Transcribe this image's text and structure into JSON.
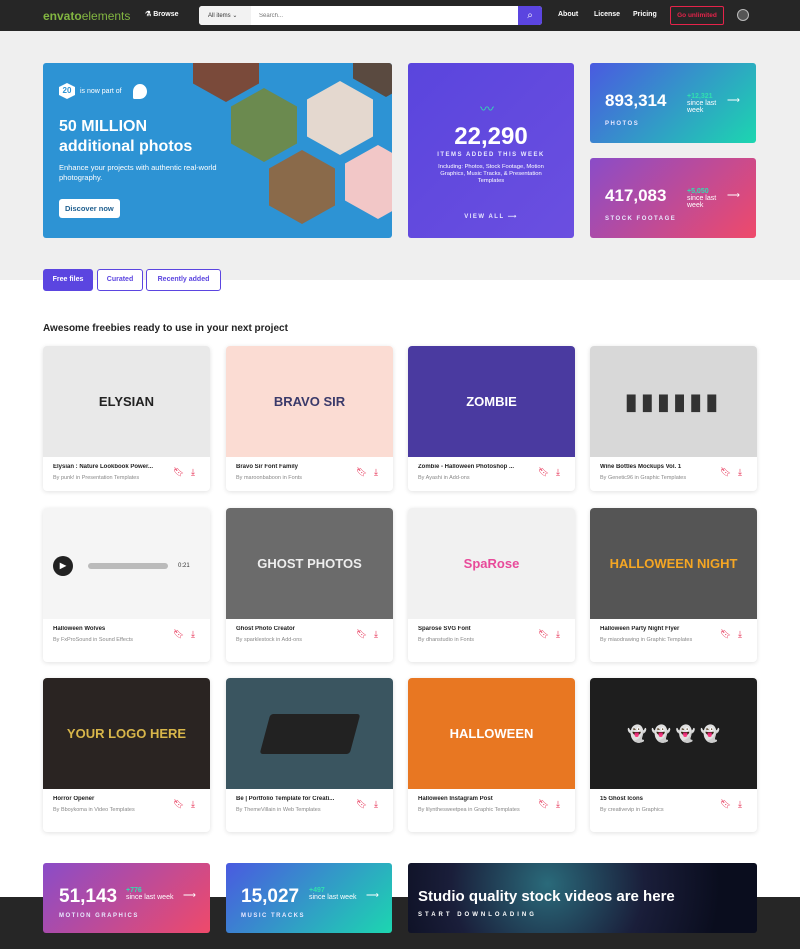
{
  "header": {
    "logo_a": "envato",
    "logo_b": "elements",
    "browse": "Browse",
    "search_category": "All items ⌄",
    "search_placeholder": "Search...",
    "nav": [
      "About",
      "License",
      "Pricing"
    ],
    "cta": "Go unlimited"
  },
  "hero": {
    "badge": "20",
    "part_of": "is now part of",
    "title_1": "50 MILLION",
    "title_2": "additional photos",
    "subtitle": "Enhance your projects with authentic real-world photography.",
    "button": "Discover now",
    "weekly": {
      "count": "22,290",
      "label": "ITEMS ADDED THIS WEEK",
      "desc": "Including: Photos, Stock Footage, Motion Graphics, Music Tracks, & Presentation Templates",
      "link": "VIEW ALL ⟶"
    },
    "photos": {
      "count": "893,314",
      "delta": "+12,321",
      "since": "since last week",
      "label": "PHOTOS"
    },
    "footage": {
      "count": "417,083",
      "delta": "+5,050",
      "since": "since last week",
      "label": "STOCK FOOTAGE"
    }
  },
  "tabs": [
    "Free files",
    "Curated",
    "Recently added"
  ],
  "section_title": "Awesome freebies ready to use in your next project",
  "items": [
    {
      "title": "Elysian : Nature Lookbook Power...",
      "by": "By punk! in Presentation Templates",
      "thumb": "ELYSIAN",
      "bg": "#e9e9e9",
      "fg": "#222"
    },
    {
      "title": "Bravo Sir Font Family",
      "by": "By maroonbaboon in Fonts",
      "thumb": "BRAVO SIR",
      "bg": "#fbdcd3",
      "fg": "#3a3a6a"
    },
    {
      "title": "Zombie - Halloween Photoshop ...",
      "by": "By Ayashi in Add-ons",
      "thumb": "ZOMBIE",
      "bg": "#4a3aa0",
      "fg": "#fff"
    },
    {
      "title": "Wine Bottles Mockups Vol. 1",
      "by": "By Genetic96 in Graphic Templates",
      "thumb": "",
      "bg": "#d8d8d8",
      "fg": "#333"
    },
    {
      "title": "Halloween Wolves",
      "by": "By FxProSound in Sound Effects",
      "thumb": "",
      "duration": "0:21",
      "bg": "#f5f5f5",
      "fg": "#333"
    },
    {
      "title": "Ghost Photo Creator",
      "by": "By sparklestock in Add-ons",
      "thumb": "GHOST PHOTOS",
      "bg": "#6b6b6b",
      "fg": "#eee"
    },
    {
      "title": "Sparose SVG Font",
      "by": "By dhanstudio in Fonts",
      "thumb": "SpaRose",
      "bg": "#f1f1f1",
      "fg": "#e84a9a"
    },
    {
      "title": "Halloween Party Night Flyer",
      "by": "By miaodrawing in Graphic Templates",
      "thumb": "HALLOWEEN NIGHT",
      "bg": "#555",
      "fg": "#f5a623"
    },
    {
      "title": "Horror Opener",
      "by": "By Bboykoma in Video Templates",
      "thumb": "YOUR LOGO HERE",
      "bg": "#2a2422",
      "fg": "#d8b64a"
    },
    {
      "title": "Be | Portfolio Template for Creati...",
      "by": "By ThemeVillain in Web Templates",
      "thumb": "",
      "bg": "#3a5560",
      "fg": "#fff"
    },
    {
      "title": "Halloween Instagram Post",
      "by": "By lilynthesweetpea in Graphic Templates",
      "thumb": "HALLOWEEN",
      "bg": "#e87722",
      "fg": "#fff"
    },
    {
      "title": "15 Ghost Icons",
      "by": "By creativevip in Graphics",
      "thumb": "👻 👻 👻 👻",
      "bg": "#1e1e1e",
      "fg": "#fff"
    }
  ],
  "bottom": {
    "motion": {
      "count": "51,143",
      "delta": "+776",
      "since": "since last week",
      "label": "MOTION GRAPHICS"
    },
    "music": {
      "count": "15,027",
      "delta": "+497",
      "since": "since last week",
      "label": "MUSIC TRACKS"
    },
    "promo": {
      "title": "Studio quality stock videos are here",
      "cta": "START DOWNLOADING"
    }
  },
  "colors": {
    "accent": "#5b45e0",
    "brand_green": "#82b541",
    "red": "#e5234a",
    "header": "#262626"
  }
}
